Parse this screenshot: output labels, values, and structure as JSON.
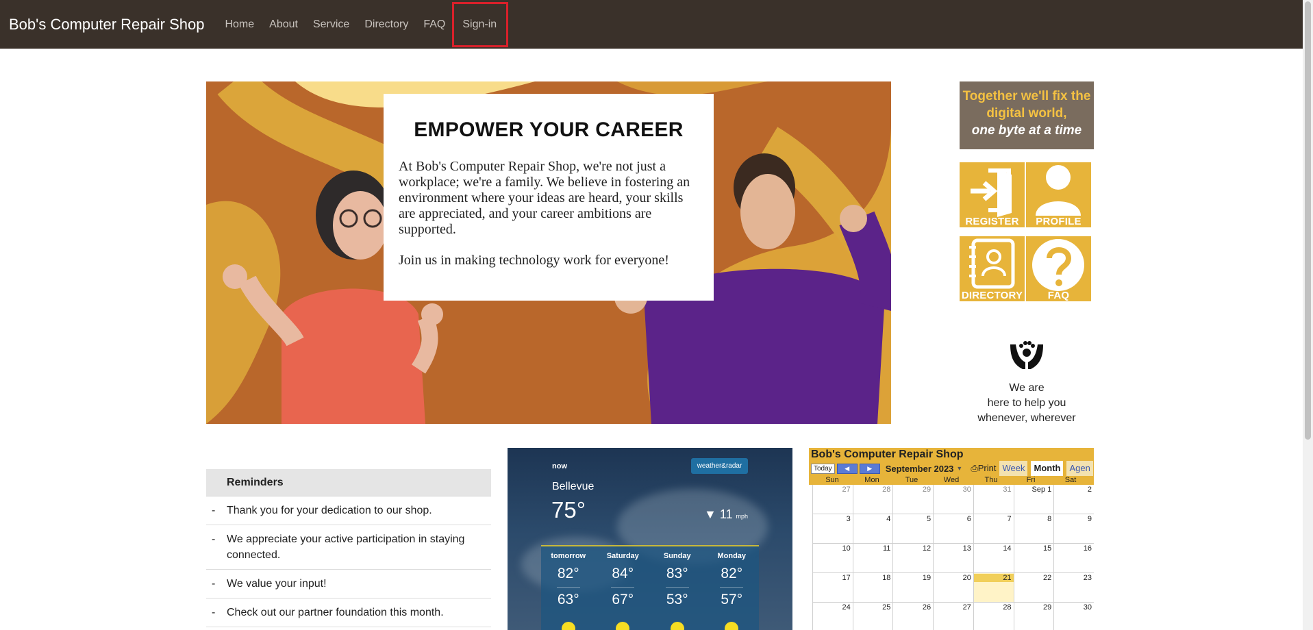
{
  "nav": {
    "brand": "Bob's Computer Repair Shop",
    "links": [
      "Home",
      "About",
      "Service",
      "Directory",
      "FAQ"
    ],
    "signin": "Sign-in"
  },
  "hero": {
    "title": "EMPOWER YOUR CAREER",
    "body": "At Bob's Computer Repair Shop, we're not just a workplace; we're a family. We believe in fostering an environment where your ideas are heard, your skills are appreciated, and your career ambitions are supported.",
    "join": "Join us in making technology work for everyone!"
  },
  "tagline": {
    "line1": "Together we'll fix the",
    "line2": "digital world,",
    "line3": "one byte at a time"
  },
  "tiles": [
    {
      "label": "REGISTER",
      "icon": "door-enter-icon"
    },
    {
      "label": "PROFILE",
      "icon": "person-icon"
    },
    {
      "label": "DIRECTORY",
      "icon": "address-book-icon"
    },
    {
      "label": "FAQ",
      "icon": "question-icon"
    }
  ],
  "help": {
    "line1": "We are",
    "line2": "here to help you",
    "line3": "whenever, wherever"
  },
  "reminders": {
    "title": "Reminders",
    "items": [
      "Thank you for your dedication to our shop.",
      "We appreciate your active participation in staying connected.",
      "We value your input!",
      "Check out our partner foundation this month."
    ]
  },
  "weather": {
    "now": "now",
    "brand": "weather&radar",
    "city": "Bellevue",
    "temp": "75°",
    "wind_speed": "11",
    "wind_unit": "mph",
    "forecast": [
      {
        "day": "tomorrow",
        "hi": "82°",
        "lo": "63°"
      },
      {
        "day": "Saturday",
        "hi": "84°",
        "lo": "67°"
      },
      {
        "day": "Sunday",
        "hi": "83°",
        "lo": "53°"
      },
      {
        "day": "Monday",
        "hi": "82°",
        "lo": "57°"
      }
    ]
  },
  "calendar": {
    "title": "Bob's Computer Repair Shop",
    "today_btn": "Today",
    "month": "September 2023",
    "print": "Print",
    "tabs": [
      "Week",
      "Month",
      "Agen"
    ],
    "dow": [
      "Sun",
      "Mon",
      "Tue",
      "Wed",
      "Thu",
      "Fri",
      "Sat"
    ],
    "weeks": [
      [
        "27",
        "28",
        "29",
        "30",
        "31",
        "Sep 1",
        "2"
      ],
      [
        "3",
        "4",
        "5",
        "6",
        "7",
        "8",
        "9"
      ],
      [
        "10",
        "11",
        "12",
        "13",
        "14",
        "15",
        "16"
      ],
      [
        "17",
        "18",
        "19",
        "20",
        "21",
        "22",
        "23"
      ],
      [
        "24",
        "25",
        "26",
        "27",
        "28",
        "29",
        "30"
      ]
    ],
    "today": "21"
  }
}
